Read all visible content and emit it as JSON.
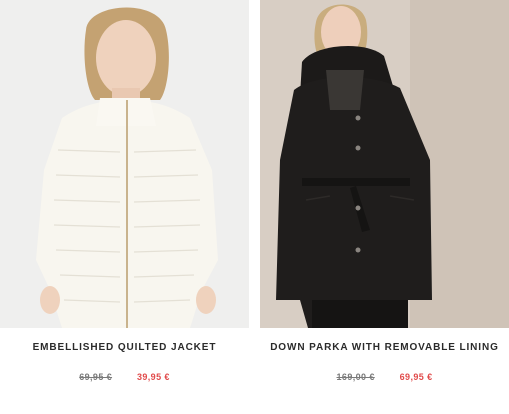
{
  "products": [
    {
      "name": "EMBELLISHED QUILTED JACKET",
      "old_price": "69,95 €",
      "new_price": "39,95 €",
      "image": "woman-in-white-quilted-jacket"
    },
    {
      "name": "DOWN PARKA WITH REMOVABLE LINING",
      "old_price": "169,00 €",
      "new_price": "69,95 €",
      "image": "woman-in-black-belted-parka"
    }
  ],
  "colors": {
    "sale_price": "#e14b4b",
    "old_price": "#7a7a7a",
    "title": "#2b2b2b"
  }
}
